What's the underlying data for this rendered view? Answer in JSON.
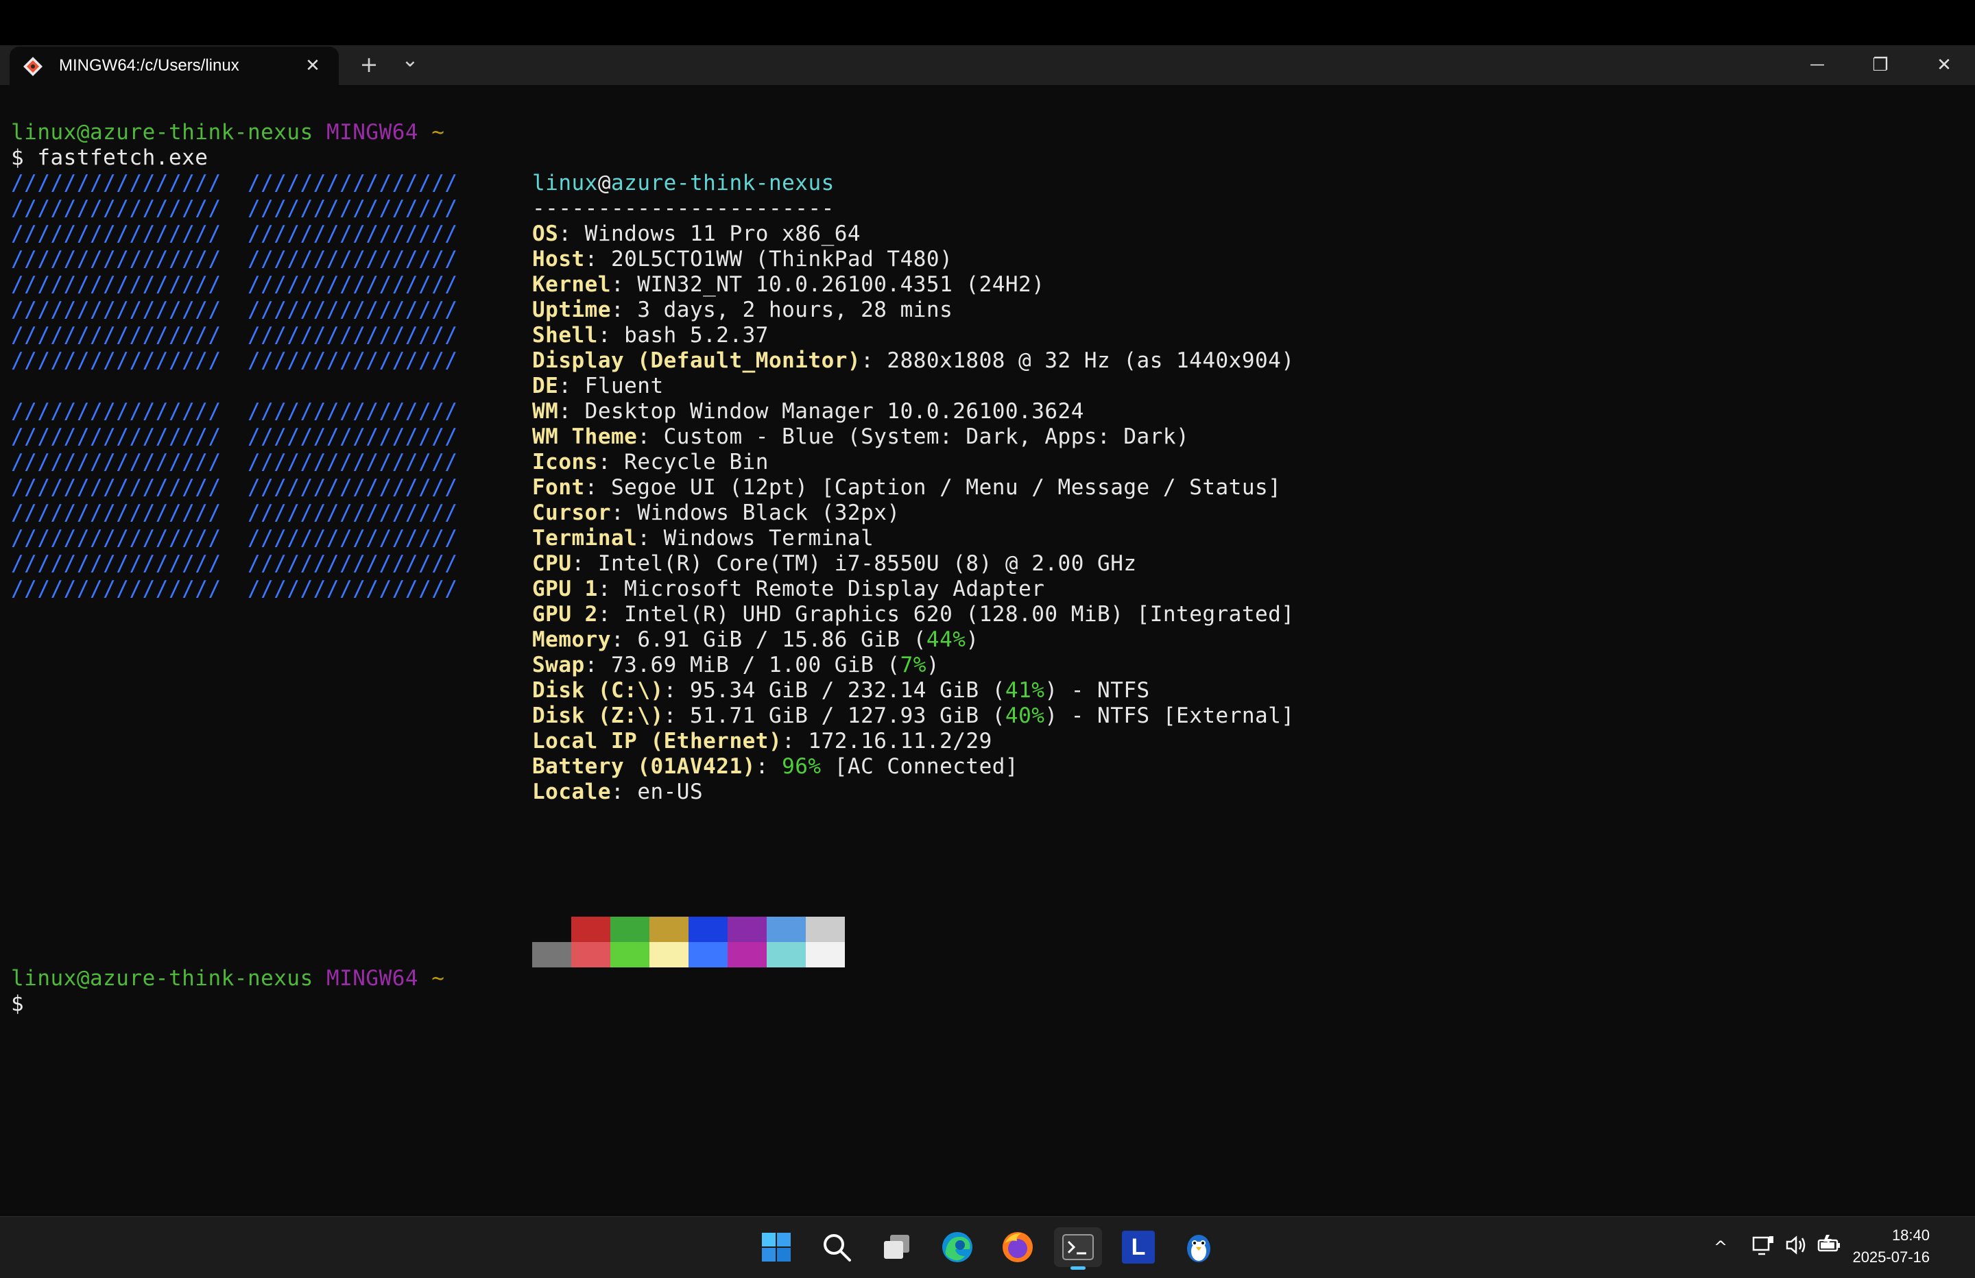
{
  "window": {
    "tab_title": "MINGW64:/c/Users/linux",
    "tab_close": "✕",
    "new_tab": "+",
    "tab_dropdown": "⌄",
    "minimize": "—",
    "maximize": "❐",
    "close": "✕"
  },
  "terminal": {
    "prompt1": {
      "user_host": "linux@azure-think-nexus",
      "env": "MINGW64",
      "dir": "~"
    },
    "command_line": "$ fastfetch.exe",
    "logo_row": "////////////////  ////////////////",
    "info_title": {
      "user": "linux",
      "at": "@",
      "host": "azure-think-nexus"
    },
    "separator": "-----------------------",
    "info": {
      "os": {
        "key": "OS",
        "value": "Windows 11 Pro x86_64"
      },
      "host": {
        "key": "Host",
        "value": "20L5CTO1WW (ThinkPad T480)"
      },
      "kernel": {
        "key": "Kernel",
        "value": "WIN32_NT 10.0.26100.4351 (24H2)"
      },
      "uptime": {
        "key": "Uptime",
        "value": "3 days, 2 hours, 28 mins"
      },
      "shell": {
        "key": "Shell",
        "value": "bash 5.2.37"
      },
      "display": {
        "key": "Display (Default_Monitor)",
        "value": "2880x1808 @ 32 Hz (as 1440x904)"
      },
      "de": {
        "key": "DE",
        "value": "Fluent"
      },
      "wm": {
        "key": "WM",
        "value": "Desktop Window Manager 10.0.26100.3624"
      },
      "wm_theme": {
        "key": "WM Theme",
        "value": "Custom - Blue (System: Dark, Apps: Dark)"
      },
      "icons": {
        "key": "Icons",
        "value": "Recycle Bin"
      },
      "font": {
        "key": "Font",
        "value": "Segoe UI (12pt) [Caption / Menu / Message / Status]"
      },
      "cursor": {
        "key": "Cursor",
        "value": "Windows Black (32px)"
      },
      "terminal": {
        "key": "Terminal",
        "value": "Windows Terminal"
      },
      "cpu": {
        "key": "CPU",
        "value": "Intel(R) Core(TM) i7-8550U (8) @ 2.00 GHz"
      },
      "gpu1": {
        "key": "GPU 1",
        "value": "Microsoft Remote Display Adapter"
      },
      "gpu2": {
        "key": "GPU 2",
        "value": "Intel(R) UHD Graphics 620 (128.00 MiB) [Integrated]"
      },
      "memory": {
        "key": "Memory",
        "pre": "6.91 GiB / 15.86 GiB (",
        "pct": "44%",
        "post": ")"
      },
      "swap": {
        "key": "Swap",
        "pre": "73.69 MiB / 1.00 GiB (",
        "pct": "7%",
        "post": ")"
      },
      "disk_c": {
        "key": "Disk (C:\\)",
        "pre": "95.34 GiB / 232.14 GiB (",
        "pct": "41%",
        "post": ") - NTFS"
      },
      "disk_z": {
        "key": "Disk (Z:\\)",
        "pre": "51.71 GiB / 127.93 GiB (",
        "pct": "40%",
        "post": ") - NTFS [External]"
      },
      "local_ip": {
        "key": "Local IP (Ethernet)",
        "value": "172.16.11.2/29"
      },
      "battery": {
        "key": "Battery (01AV421)",
        "pct": "96%",
        "post": " [AC Connected]"
      },
      "locale": {
        "key": "Locale",
        "value": "en-US"
      }
    },
    "palette": {
      "row1": [
        "#0c0c0c",
        "#c42b2b",
        "#3fa83a",
        "#c19c32",
        "#1a3fe0",
        "#8a2ca8",
        "#5a9ae0",
        "#cccccc"
      ],
      "row2": [
        "#767676",
        "#e0555a",
        "#5fcf3a",
        "#f8f0a8",
        "#3b78ff",
        "#b62ca8",
        "#7fd6d6",
        "#f2f2f2"
      ]
    },
    "prompt2": {
      "user_host": "linux@azure-think-nexus",
      "env": "MINGW64",
      "dir": "~"
    },
    "prompt2_cursor": "$"
  },
  "taskbar": {
    "apps": [
      "start-icon",
      "search-icon",
      "task-view-icon",
      "edge-icon",
      "firefox-icon",
      "terminal-icon",
      "l-app-icon",
      "penguin-icon"
    ],
    "l_app_letter": "L",
    "tray_chevron": "^",
    "time": "18:40",
    "date": "2025-07-16"
  }
}
